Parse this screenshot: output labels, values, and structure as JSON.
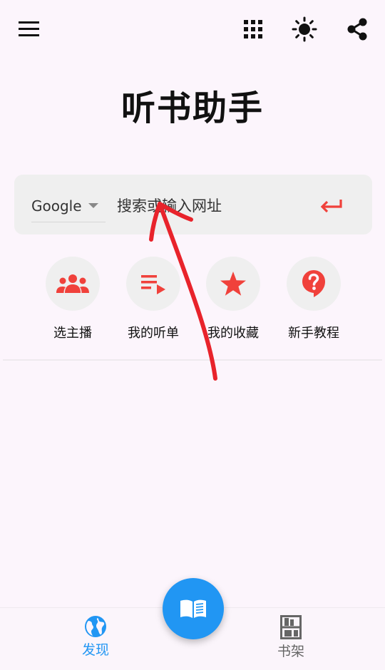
{
  "app": {
    "title": "听书助手"
  },
  "topbar": {
    "icons": [
      "menu-icon",
      "grid-icon",
      "brightness-icon",
      "share-icon"
    ]
  },
  "search": {
    "engine": "Google",
    "placeholder": "搜索或输入网址",
    "value": ""
  },
  "quick_actions": [
    {
      "label": "选主播",
      "icon": "group-icon"
    },
    {
      "label": "我的听单",
      "icon": "playlist-icon"
    },
    {
      "label": "我的收藏",
      "icon": "star-icon"
    },
    {
      "label": "新手教程",
      "icon": "help-icon"
    }
  ],
  "bottom_nav": {
    "discover": "发现",
    "shelf": "书架",
    "active": "discover"
  },
  "colors": {
    "accent_red": "#f0413b",
    "accent_blue": "#2196f3",
    "background": "#fcf5fc",
    "card": "#efefef",
    "annotation_red": "#e8232b"
  }
}
